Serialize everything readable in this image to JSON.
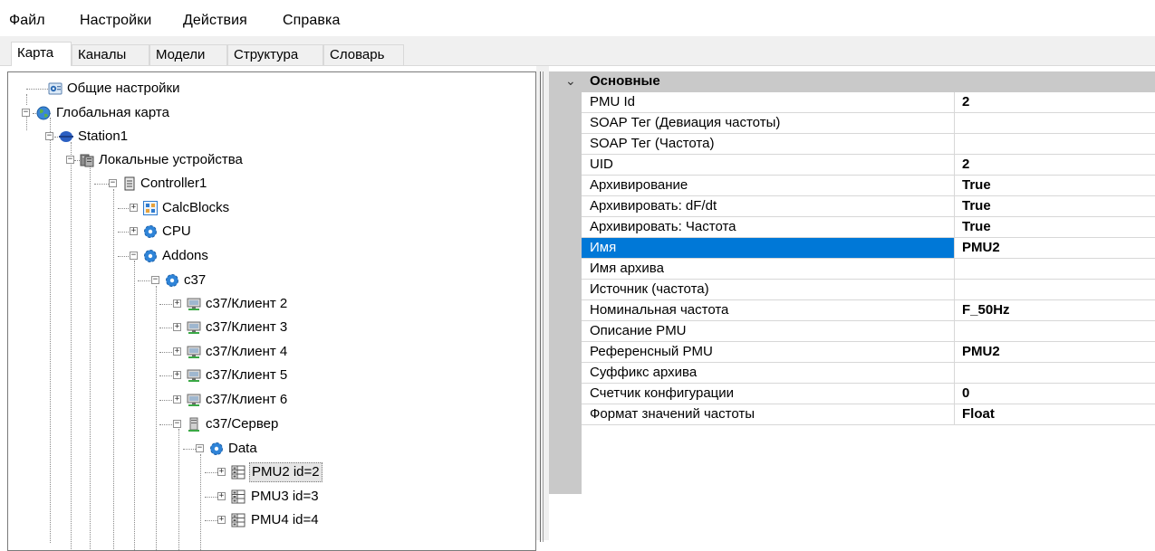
{
  "menu": [
    "Файл",
    "Настройки",
    "Действия",
    "Справка"
  ],
  "tabs": [
    "Карта",
    "Каналы",
    "Модели",
    "Структура",
    "Словарь"
  ],
  "active_tab": "Карта",
  "tree": [
    {
      "label": "Общие настройки",
      "icon": "settings-icon"
    },
    {
      "label": "Глобальная карта",
      "icon": "globe-icon"
    },
    {
      "label": "Station1",
      "icon": "station-icon"
    },
    {
      "label": "Локальные устройства",
      "icon": "devices-icon"
    },
    {
      "label": "Controller1",
      "icon": "controller-icon"
    },
    {
      "label": "CalcBlocks",
      "icon": "calcblocks-icon"
    },
    {
      "label": "CPU",
      "icon": "gear-icon"
    },
    {
      "label": "Addons",
      "icon": "gear-icon"
    },
    {
      "label": "c37",
      "icon": "gear-icon"
    },
    {
      "label": "c37/Клиент 2",
      "icon": "client-icon"
    },
    {
      "label": "c37/Клиент 3",
      "icon": "client-icon"
    },
    {
      "label": "c37/Клиент 4",
      "icon": "client-icon"
    },
    {
      "label": "c37/Клиент 5",
      "icon": "client-icon"
    },
    {
      "label": "c37/Клиент 6",
      "icon": "client-icon"
    },
    {
      "label": "c37/Сервер",
      "icon": "server-icon"
    },
    {
      "label": "Data",
      "icon": "gear-icon"
    },
    {
      "label": "PMU2 id=2",
      "icon": "pmu-icon"
    },
    {
      "label": "PMU3 id=3",
      "icon": "pmu-icon"
    },
    {
      "label": "PMU4 id=4",
      "icon": "pmu-icon"
    }
  ],
  "properties": {
    "category": "Основные",
    "rows": [
      {
        "name": "PMU Id",
        "value": "2"
      },
      {
        "name": "SOAP Тег (Девиация частоты)",
        "value": ""
      },
      {
        "name": "SOAP Тег (Частота)",
        "value": ""
      },
      {
        "name": "UID",
        "value": "2"
      },
      {
        "name": "Архивирование",
        "value": "True"
      },
      {
        "name": "Архивировать: dF/dt",
        "value": "True"
      },
      {
        "name": "Архивировать: Частота",
        "value": "True"
      },
      {
        "name": "Имя",
        "value": "PMU2"
      },
      {
        "name": "Имя архива",
        "value": ""
      },
      {
        "name": "Источник (частота)",
        "value": ""
      },
      {
        "name": "Номинальная частота",
        "value": "F_50Hz"
      },
      {
        "name": "Описание PMU",
        "value": ""
      },
      {
        "name": "Референсный PMU",
        "value": "PMU2"
      },
      {
        "name": "Суффикс архива",
        "value": ""
      },
      {
        "name": "Счетчик конфигурации",
        "value": "0"
      },
      {
        "name": "Формат значений частоты",
        "value": "Float"
      }
    ]
  },
  "colors": {
    "selection": "#0078d7",
    "category_bg": "#c9c9c9"
  }
}
